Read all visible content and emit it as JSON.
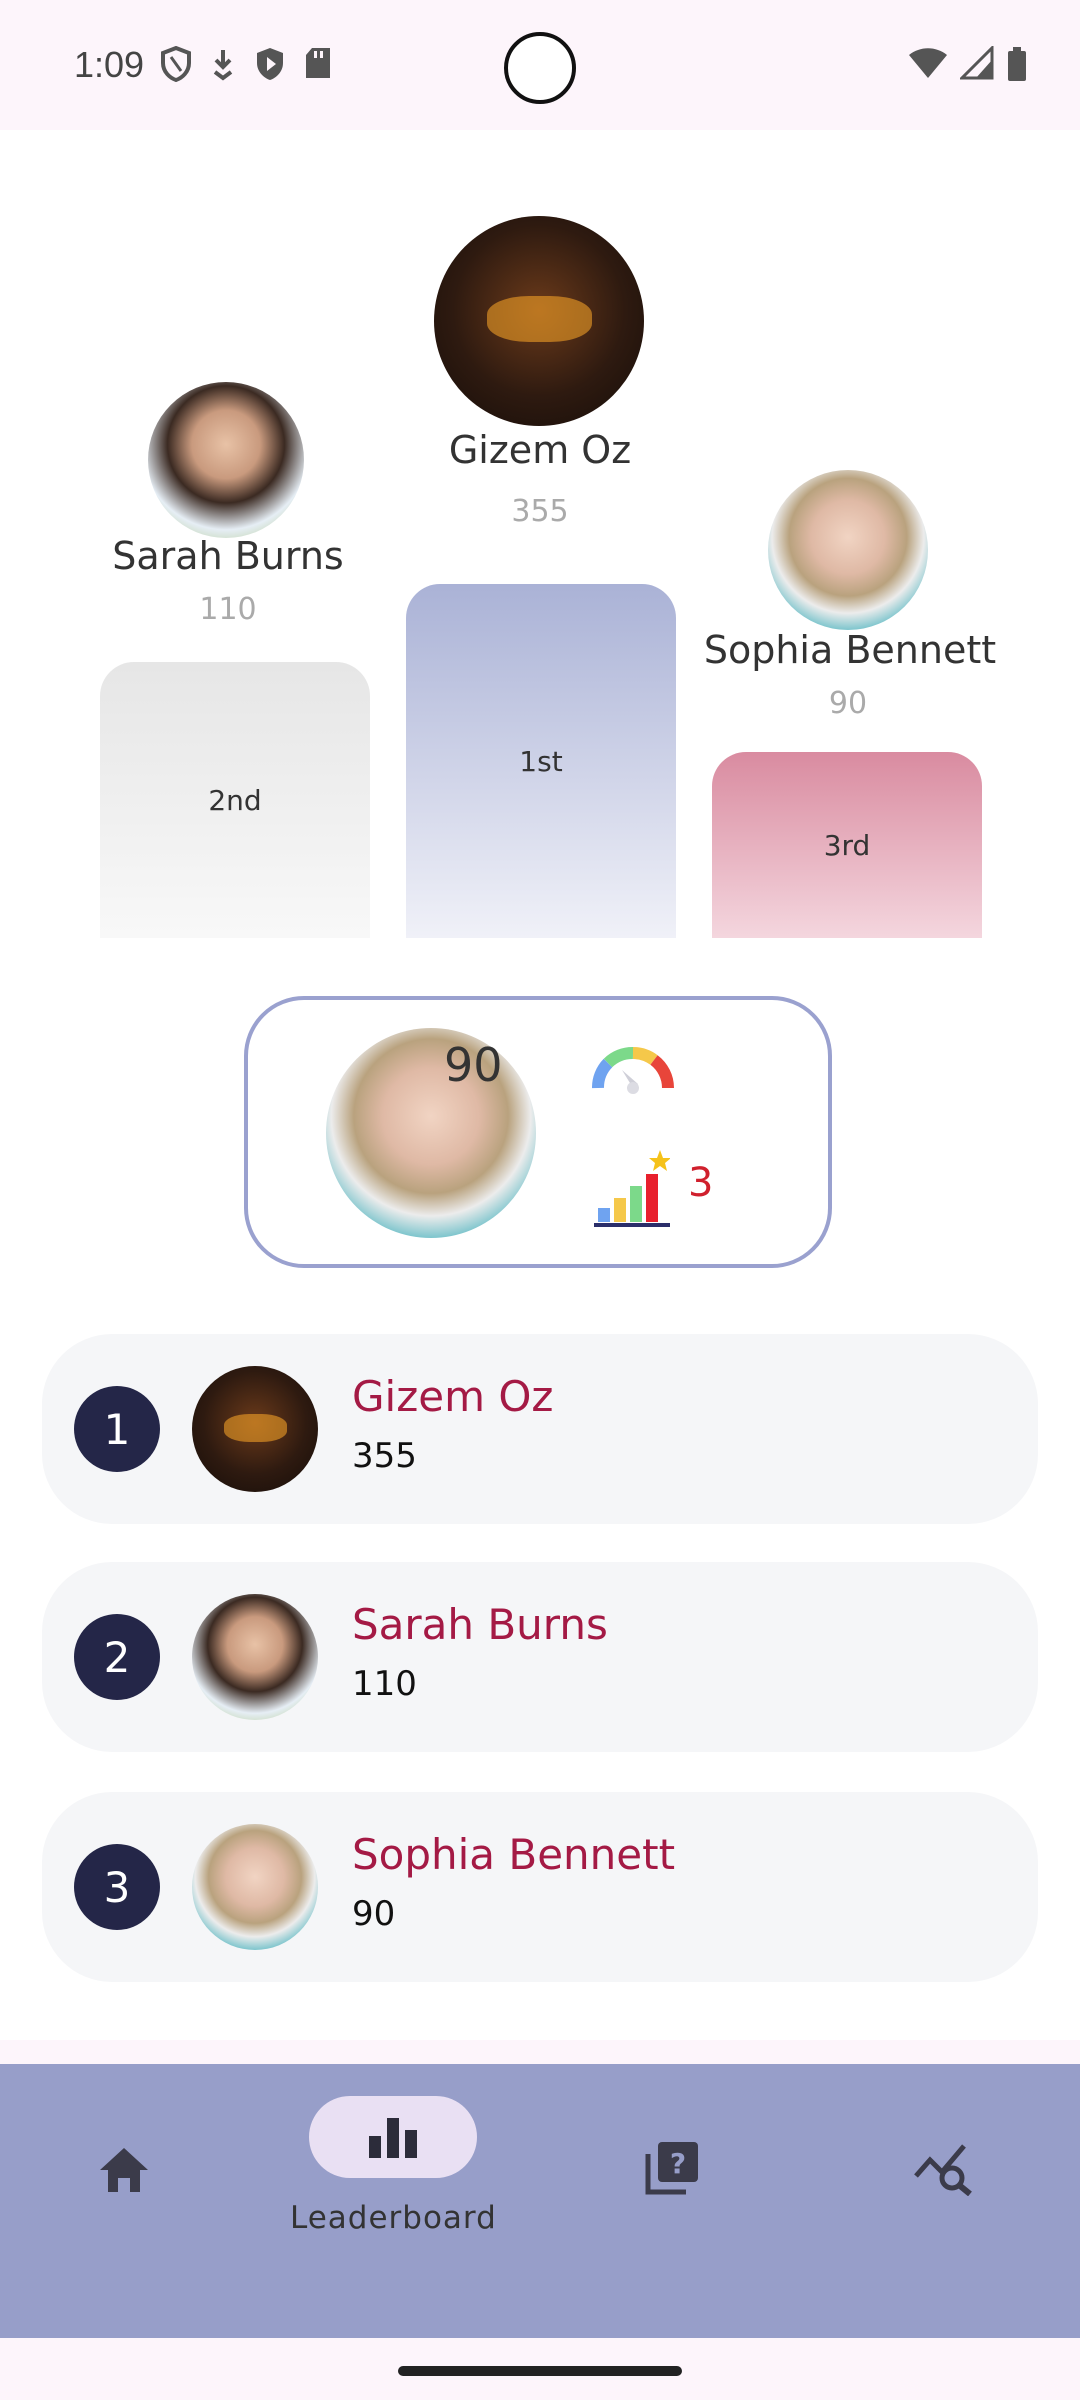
{
  "status_bar": {
    "time": "1:09",
    "icons_left": [
      "shield-outline-icon",
      "download-pin-icon",
      "shield-play-icon",
      "sd-card-icon"
    ],
    "icons_right": [
      "wifi-icon",
      "signal-icon",
      "battery-icon"
    ]
  },
  "podium": [
    {
      "place": "2nd",
      "name": "Sarah Burns",
      "score": "110"
    },
    {
      "place": "1st",
      "name": "Gizem Oz",
      "score": "355"
    },
    {
      "place": "3rd",
      "name": "Sophia Bennett",
      "score": "90"
    }
  ],
  "current_user": {
    "score": "90",
    "rank": "3",
    "score_icon": "gauge-icon",
    "rank_icon": "rank-chart-icon"
  },
  "leaderboard": [
    {
      "rank": "1",
      "name": "Gizem Oz",
      "score": "355"
    },
    {
      "rank": "2",
      "name": "Sarah Burns",
      "score": "110"
    },
    {
      "rank": "3",
      "name": "Sophia Bennett",
      "score": "90"
    }
  ],
  "nav": {
    "items": [
      {
        "icon": "home-icon"
      },
      {
        "icon": "leaderboard-icon",
        "label": "Leaderboard",
        "selected": true
      },
      {
        "icon": "quiz-icon"
      },
      {
        "icon": "analytics-search-icon"
      }
    ],
    "colors": {
      "bar": "#979ec9",
      "pill": "#e9e0f3"
    }
  },
  "colors": {
    "name_accent": "#a41a45",
    "rank_circle": "#242648",
    "rank_red": "#d0202d"
  }
}
